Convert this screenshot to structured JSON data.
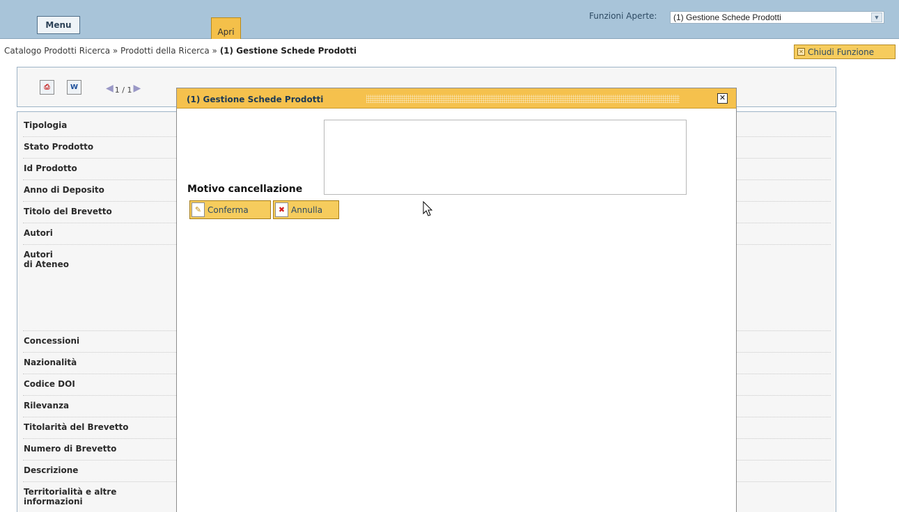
{
  "topbar": {
    "menu_label": "Menu",
    "apri_label": "Apri",
    "funzioni_label": "Funzioni Aperte:",
    "funzioni_selected": "(1) Gestione Schede Prodotti"
  },
  "breadcrumb": {
    "path": "Catalogo Prodotti Ricerca » Prodotti della Ricerca » ",
    "current": "(1) Gestione Schede Prodotti"
  },
  "chiudi_funzione_label": "Chiudi Funzione",
  "toolbar": {
    "pdf_icon": "pdf-icon",
    "doc_icon": "word-doc-icon",
    "pager_text": "1 / 1"
  },
  "fields": [
    "Tipologia",
    "Stato Prodotto",
    "Id Prodotto",
    "Anno di Deposito",
    "Titolo del Brevetto",
    "Autori",
    "Autori\ndi Ateneo",
    "Concessioni",
    "Nazionalità",
    "Codice DOI",
    "Rilevanza",
    "Titolarità del Brevetto",
    "Numero di Brevetto",
    "Descrizione",
    "Territorialità e altre\ninformazioni"
  ],
  "modal": {
    "title": "(1) Gestione Schede Prodotti",
    "motivo_label": "Motivo cancellazione",
    "motivo_value": "",
    "conferma_label": "Conferma",
    "annulla_label": "Annulla"
  },
  "colors": {
    "topbar_bg": "#a8c4d9",
    "accent_yellow": "#f5c14d",
    "panel_border": "#9db3c6"
  }
}
